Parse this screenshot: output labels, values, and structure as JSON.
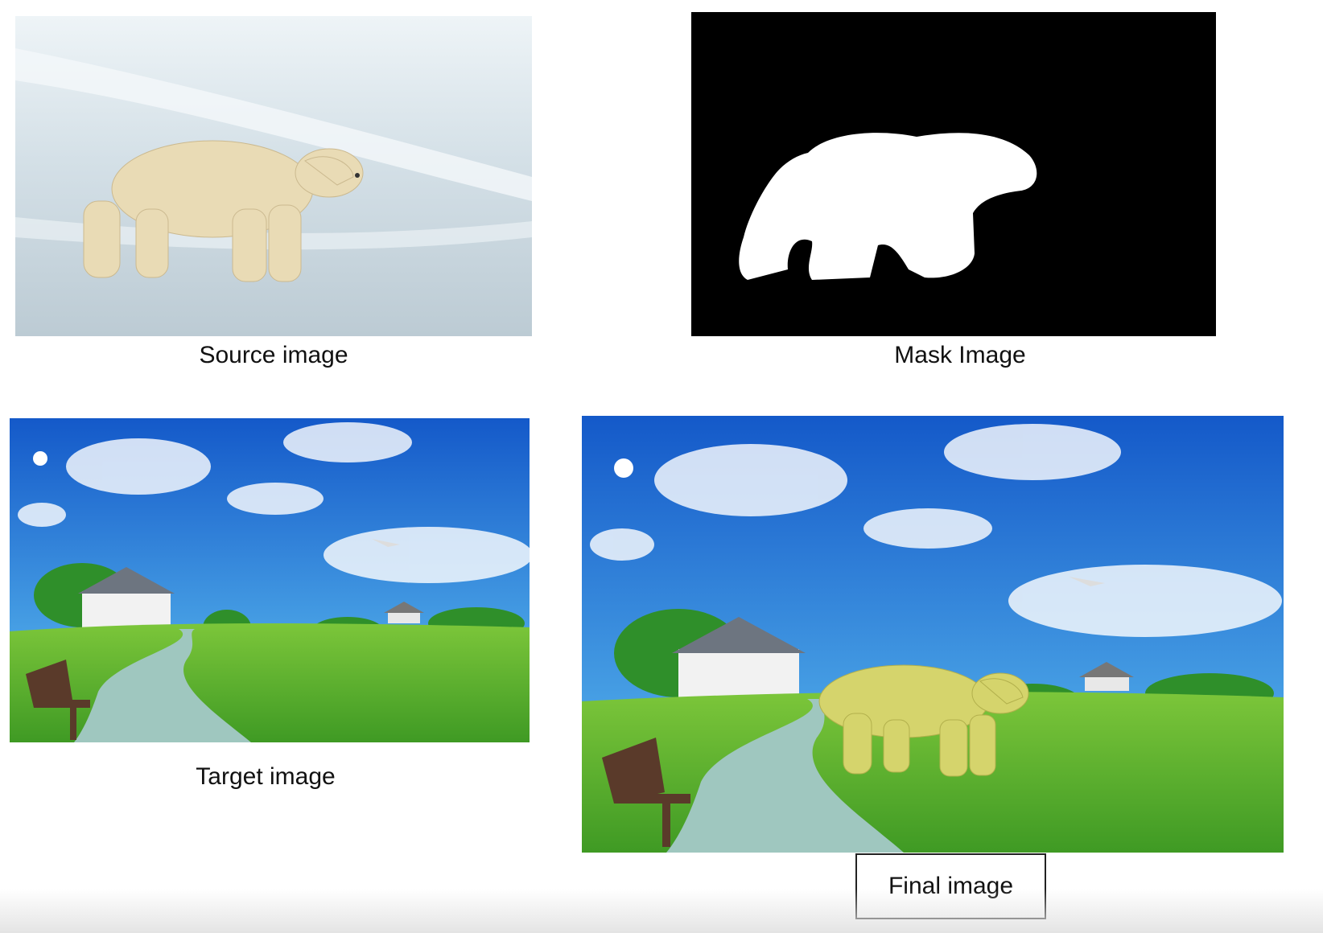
{
  "captions": {
    "source": "Source image",
    "mask": "Mask Image",
    "target": "Target image",
    "final": "Final image"
  },
  "colors": {
    "snow": "#c9d6de",
    "bear": "#eadcb6",
    "mask_bg": "#000000",
    "mask_fg": "#ffffff",
    "sky": "#1f6fd1",
    "grass": "#5fb52f",
    "path": "#9fc7bf",
    "bear_tinted": "#d6d36a"
  },
  "images": {
    "source": "polar-bear-on-snow",
    "mask": "polar-bear-silhouette-mask",
    "target": "green-field-with-house-and-path",
    "final": "composited-polar-bear-on-field"
  }
}
